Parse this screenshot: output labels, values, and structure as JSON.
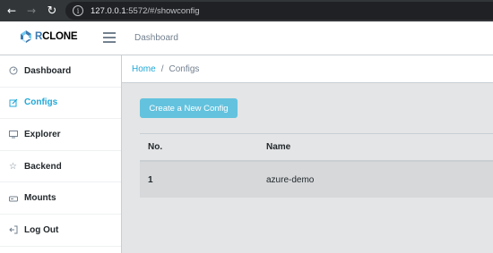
{
  "browser": {
    "url_host": "127.0.0.1",
    "url_path": ":5572/#/showconfig"
  },
  "header": {
    "brand_r": "R",
    "brand_rest": "CLONE",
    "nav_link": "Dashboard"
  },
  "sidebar": {
    "items": [
      {
        "label": "Dashboard",
        "icon": "speedometer-icon"
      },
      {
        "label": "Configs",
        "icon": "pencil-square-icon"
      },
      {
        "label": "Explorer",
        "icon": "monitor-icon"
      },
      {
        "label": "Backend",
        "icon": "star-icon"
      },
      {
        "label": "Mounts",
        "icon": "drive-icon"
      },
      {
        "label": "Log Out",
        "icon": "logout-icon"
      }
    ],
    "active_index": 1
  },
  "breadcrumb": {
    "home": "Home",
    "separator": "/",
    "current": "Configs"
  },
  "main": {
    "create_button": "Create a New Config",
    "table": {
      "headers": [
        "No.",
        "Name"
      ],
      "rows": [
        {
          "no": "1",
          "name": "azure-demo"
        }
      ]
    }
  },
  "colors": {
    "accent": "#20a8d8",
    "button": "#63c2de",
    "brand_blue": "#3f79ad"
  }
}
